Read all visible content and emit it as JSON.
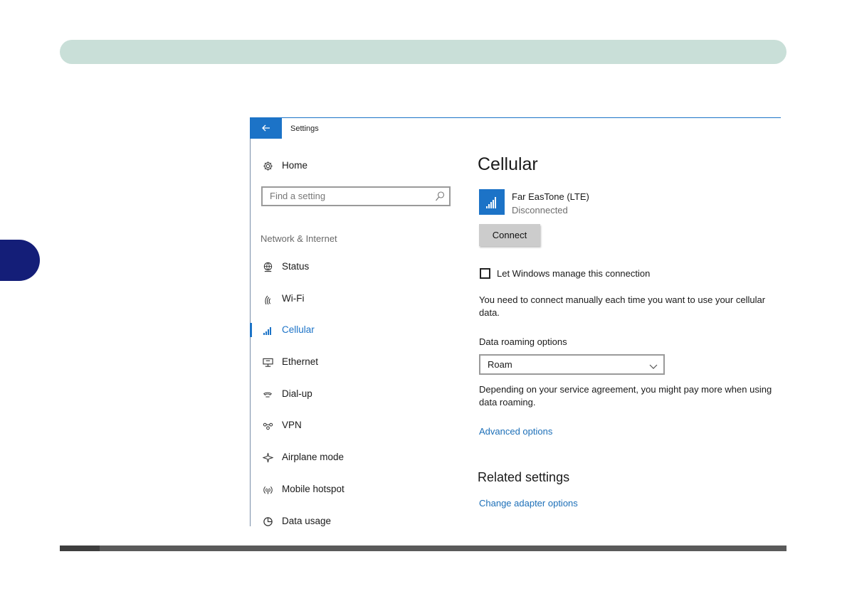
{
  "window": {
    "title": "Settings",
    "back_icon": "back-arrow-icon"
  },
  "nav": {
    "home_label": "Home",
    "search_placeholder": "Find a setting",
    "section_heading": "Network & Internet",
    "items": [
      {
        "label": "Status",
        "icon": "globe-icon",
        "active": false
      },
      {
        "label": "Wi-Fi",
        "icon": "wifi-icon",
        "active": false
      },
      {
        "label": "Cellular",
        "icon": "signal-bars-icon",
        "active": true
      },
      {
        "label": "Ethernet",
        "icon": "ethernet-icon",
        "active": false
      },
      {
        "label": "Dial-up",
        "icon": "dialup-icon",
        "active": false
      },
      {
        "label": "VPN",
        "icon": "vpn-icon",
        "active": false
      },
      {
        "label": "Airplane mode",
        "icon": "airplane-icon",
        "active": false
      },
      {
        "label": "Mobile hotspot",
        "icon": "hotspot-icon",
        "active": false
      },
      {
        "label": "Data usage",
        "icon": "data-usage-icon",
        "active": false
      }
    ]
  },
  "main": {
    "title": "Cellular",
    "network": {
      "name": "Far EasTone (LTE)",
      "status": "Disconnected",
      "icon": "signal-bars-icon"
    },
    "connect_label": "Connect",
    "manage_checkbox": {
      "label": "Let Windows manage this connection",
      "checked": false
    },
    "manual_note": "You need to connect manually each time you want to use your cellular data.",
    "roaming": {
      "label": "Data roaming options",
      "selected": "Roam"
    },
    "roaming_note": "Depending on your service agreement, you might pay more when using data roaming.",
    "advanced_link": "Advanced options",
    "related_heading": "Related settings",
    "adapter_link": "Change adapter options"
  },
  "colors": {
    "accent": "#1c73c7",
    "link": "#1c6fb8",
    "header_bar": "#c9dfd8",
    "chapter_tab": "#141e78"
  }
}
